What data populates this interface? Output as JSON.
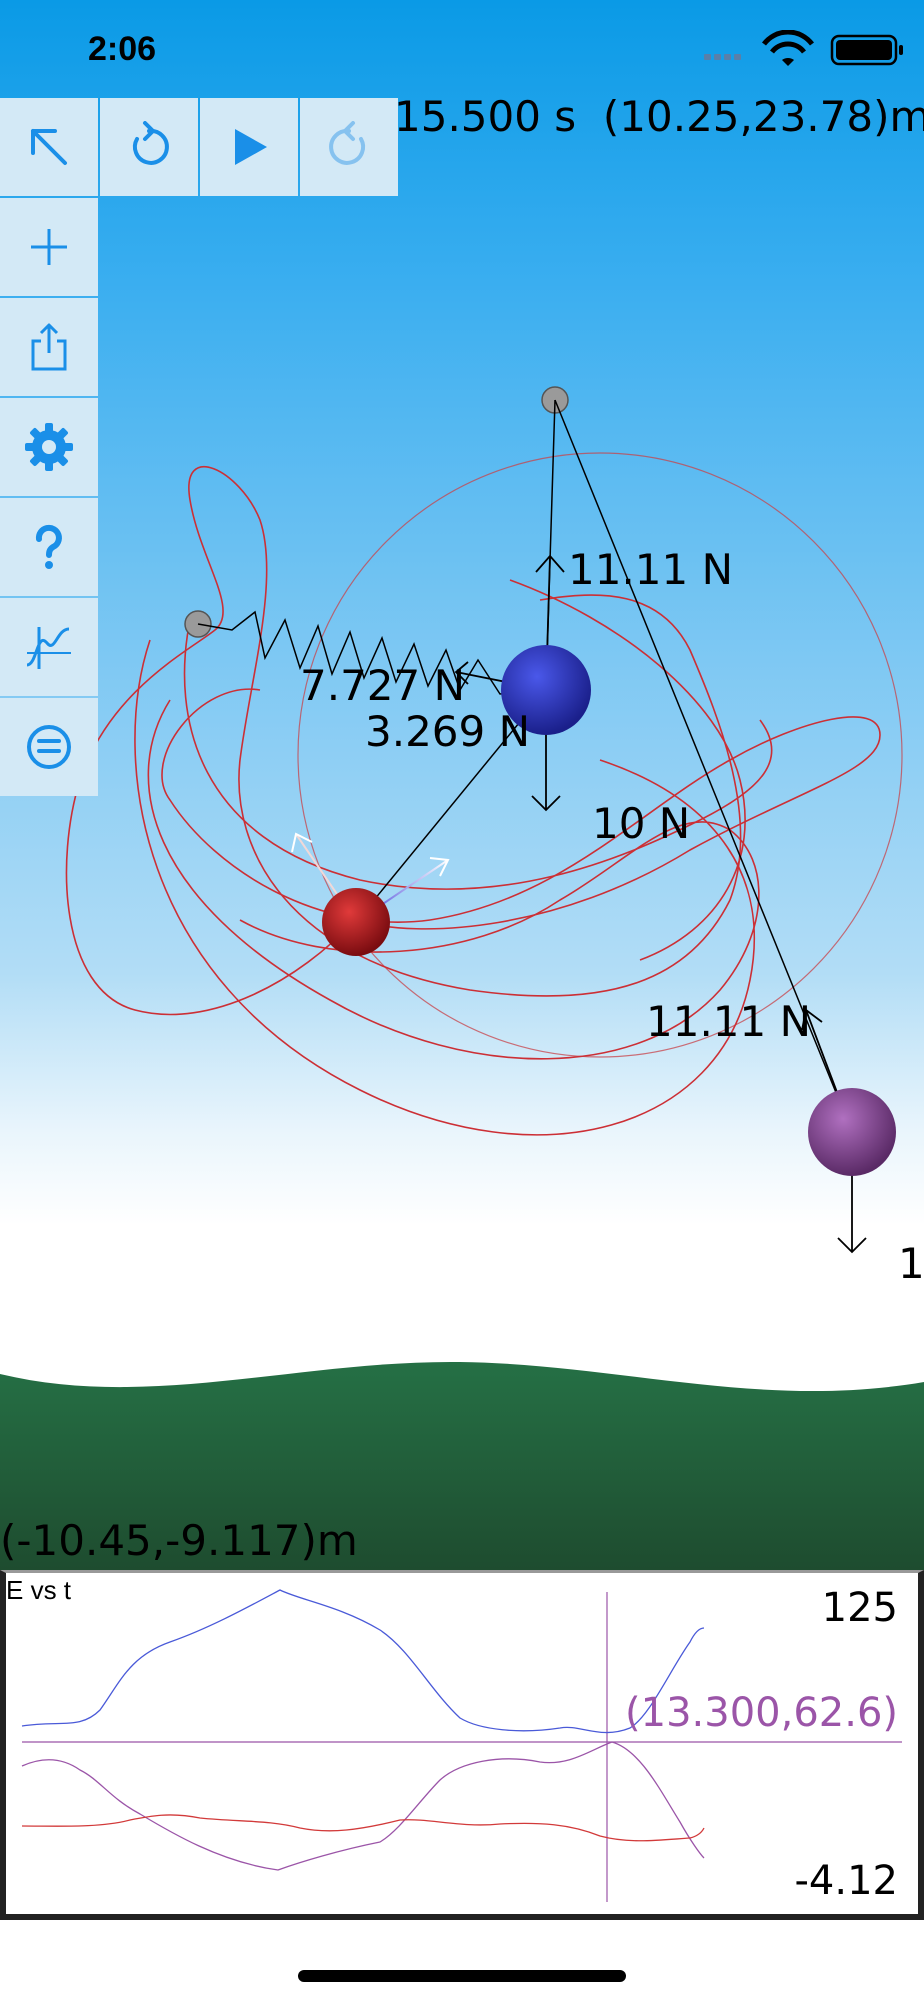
{
  "status_bar": {
    "time": "2:06"
  },
  "readouts": {
    "time_position": "15.500 s  (10.25,23.78)m",
    "corner_position": "(-10.45,-9.117)m"
  },
  "toolbar": {
    "select_icon": "arrow-up-left-icon",
    "reset_icon": "rotate-ccw-icon",
    "play_icon": "play-icon",
    "redo_icon": "rotate-cw-icon",
    "add_icon": "plus-icon",
    "share_icon": "share-icon",
    "settings_icon": "gear-icon",
    "help_icon": "question-icon",
    "graph_icon": "graph-icon",
    "menu_icon": "list-icon"
  },
  "force_labels": {
    "blue_tension": "11.11 N",
    "spring_force": "7.727 N",
    "red_link_force": "3.269 N",
    "blue_weight": "10 N",
    "purple_tension": "11.11 N",
    "purple_weight_partial": "1"
  },
  "graph": {
    "title": "E vs t",
    "max_label": "125",
    "min_label": "-4.12",
    "cursor_label": "(13.300,62.6)"
  },
  "colors": {
    "accent": "#1a8fe8",
    "trail": "#d23a3a",
    "blue_ball": "#2a33c8",
    "red_ball": "#c0181e",
    "purple_ball": "#8a4a9a",
    "grass_top": "#246b44",
    "grass_bottom": "#1f5030",
    "cursor": "#9b55a8"
  }
}
